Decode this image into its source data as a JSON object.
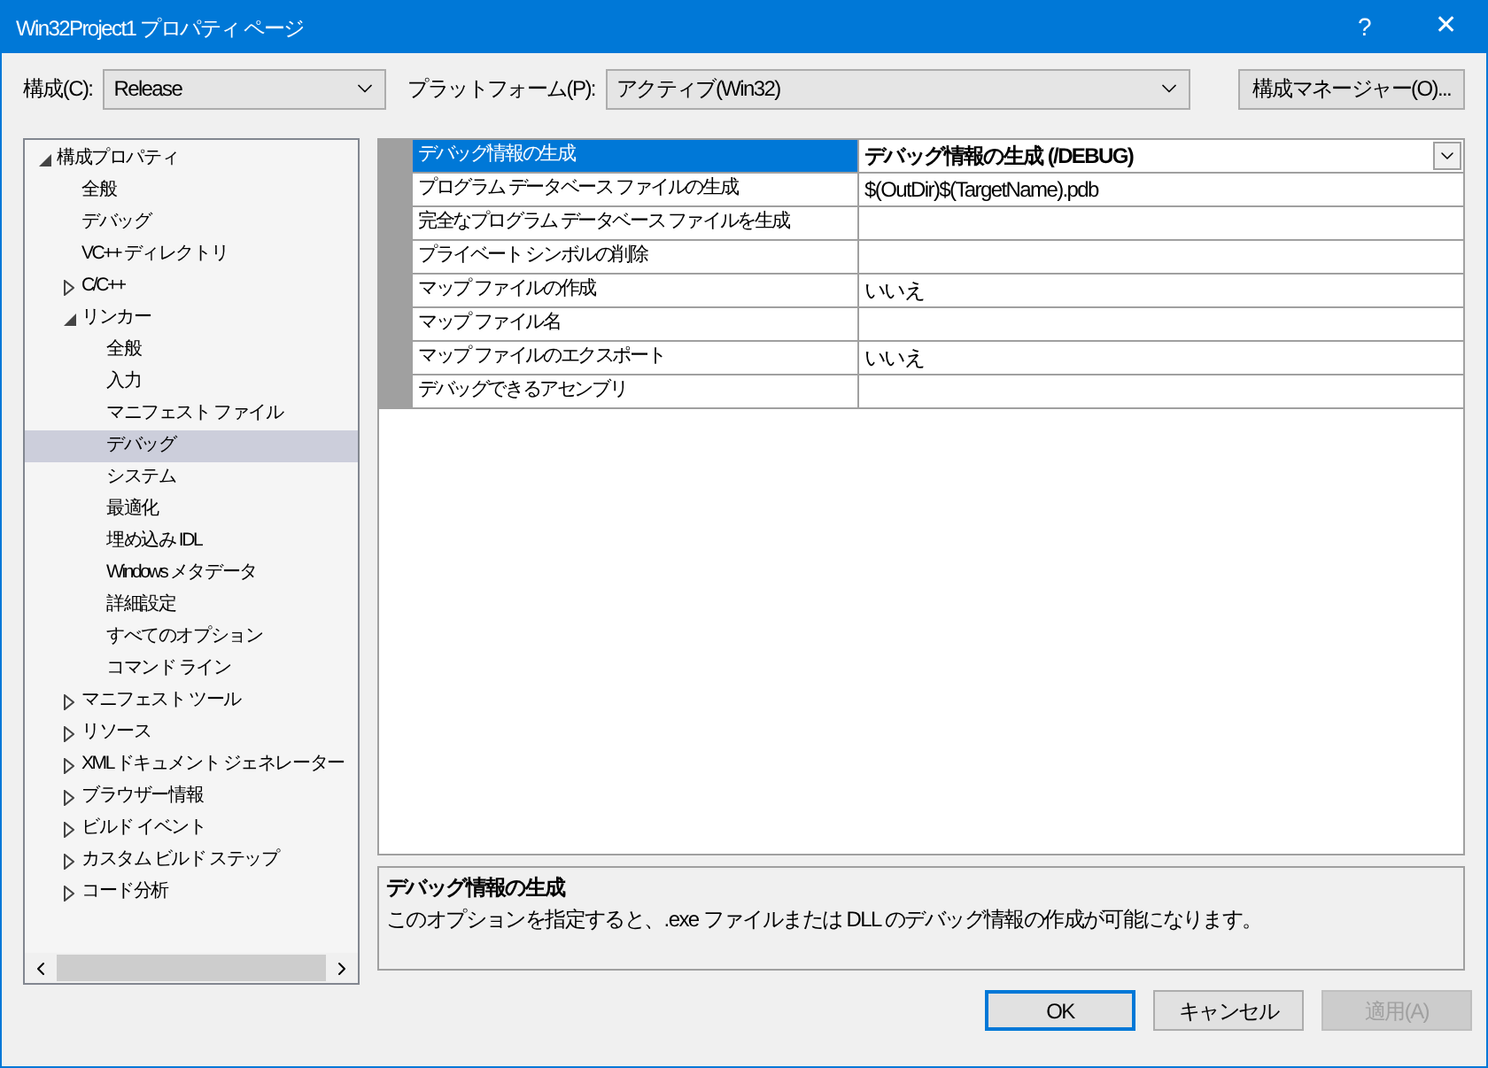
{
  "window": {
    "title": "Win32Project1 プロパティ ページ",
    "help": "?",
    "close": "✕"
  },
  "toolbar": {
    "config_label": "構成(C):",
    "config_value": "Release",
    "platform_label": "プラットフォーム(P):",
    "platform_value": "アクティブ(Win32)",
    "manager_button": "構成マネージャー(O)..."
  },
  "tree": [
    {
      "label": "構成プロパティ",
      "kind": "group",
      "expanded": true,
      "selected": false,
      "children": [
        {
          "label": "全般",
          "kind": "leaf",
          "selected": false
        },
        {
          "label": "デバッグ",
          "kind": "leaf",
          "selected": false
        },
        {
          "label": "VC++ ディレクトリ",
          "kind": "leaf",
          "selected": false
        },
        {
          "label": "C/C++",
          "kind": "group",
          "expanded": false,
          "selected": false
        },
        {
          "label": "リンカー",
          "kind": "group",
          "expanded": true,
          "selected": false,
          "children": [
            {
              "label": "全般",
              "kind": "leaf",
              "selected": false
            },
            {
              "label": "入力",
              "kind": "leaf",
              "selected": false
            },
            {
              "label": "マニフェスト ファイル",
              "kind": "leaf",
              "selected": false
            },
            {
              "label": "デバッグ",
              "kind": "leaf",
              "selected": true
            },
            {
              "label": "システム",
              "kind": "leaf",
              "selected": false
            },
            {
              "label": "最適化",
              "kind": "leaf",
              "selected": false
            },
            {
              "label": "埋め込み IDL",
              "kind": "leaf",
              "selected": false
            },
            {
              "label": "Windows メタデータ",
              "kind": "leaf",
              "selected": false
            },
            {
              "label": "詳細設定",
              "kind": "leaf",
              "selected": false
            },
            {
              "label": "すべてのオプション",
              "kind": "leaf",
              "selected": false
            },
            {
              "label": "コマンド ライン",
              "kind": "leaf",
              "selected": false
            }
          ]
        },
        {
          "label": "マニフェスト ツール",
          "kind": "group",
          "expanded": false,
          "selected": false
        },
        {
          "label": "リソース",
          "kind": "group",
          "expanded": false,
          "selected": false
        },
        {
          "label": "XML ドキュメント ジェネレーター",
          "kind": "group",
          "expanded": false,
          "selected": false
        },
        {
          "label": "ブラウザー情報",
          "kind": "group",
          "expanded": false,
          "selected": false
        },
        {
          "label": "ビルド イベント",
          "kind": "group",
          "expanded": false,
          "selected": false
        },
        {
          "label": "カスタム ビルド ステップ",
          "kind": "group",
          "expanded": false,
          "selected": false
        },
        {
          "label": "コード分析",
          "kind": "group",
          "expanded": false,
          "selected": false
        }
      ]
    }
  ],
  "properties": [
    {
      "name": "デバッグ情報の生成",
      "value": "デバッグ情報の生成 (/DEBUG)",
      "selected": true
    },
    {
      "name": "プログラム データベース ファイルの生成",
      "value": "$(OutDir)$(TargetName).pdb",
      "selected": false
    },
    {
      "name": "完全なプログラム データベース ファイルを生成",
      "selected": false
    },
    {
      "name": "プライベート シンボルの削除",
      "selected": false
    },
    {
      "name": "マップ ファイルの作成",
      "value": "いいえ",
      "selected": false
    },
    {
      "name": "マップ ファイル名",
      "selected": false
    },
    {
      "name": "マップ ファイルのエクスポート",
      "value": "いいえ",
      "selected": false
    },
    {
      "name": "デバッグできるアセンブリ",
      "selected": false
    }
  ],
  "description": {
    "title": "デバッグ情報の生成",
    "text": "このオプションを指定すると、.exe ファイルまたは DLL のデバッグ情報の作成が可能になります。"
  },
  "buttons": [
    {
      "label": "OK",
      "kind": "default",
      "disabled": false
    },
    {
      "label": "キャンセル",
      "kind": "normal",
      "disabled": false
    },
    {
      "label": "適用(A)",
      "kind": "normal",
      "disabled": true
    }
  ]
}
